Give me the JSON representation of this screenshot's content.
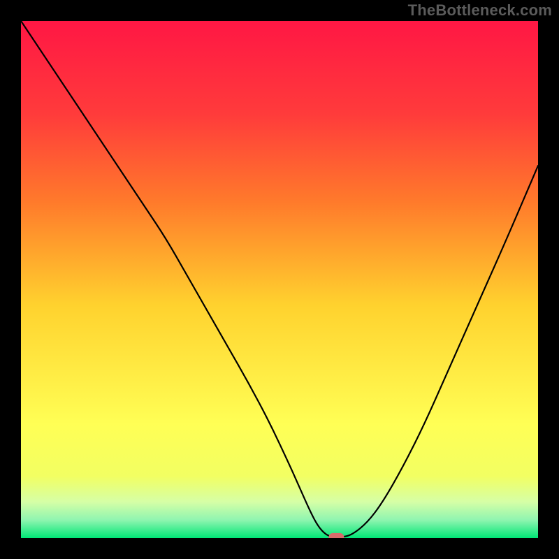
{
  "watermark": "TheBottleneck.com",
  "colors": {
    "frame_bg": "#000000",
    "gradient_top": "#ff1744",
    "gradient_upper_mid": "#ff7a2b",
    "gradient_mid": "#ffd22e",
    "gradient_lower_mid": "#f2ff62",
    "gradient_low": "#d6ffa6",
    "gradient_base": "#00e676",
    "curve": "#000000",
    "marker_fill": "#d86b6b",
    "marker_stroke": "#b24e4e"
  },
  "chart_data": {
    "type": "line",
    "title": "",
    "xlabel": "",
    "ylabel": "",
    "xlim": [
      0,
      100
    ],
    "ylim": [
      0,
      100
    ],
    "series": [
      {
        "name": "bottleneck-curve",
        "x": [
          0,
          6,
          12,
          18,
          24,
          28,
          32,
          36,
          40,
          44,
          48,
          52,
          54,
          56,
          57.5,
          59,
          60.5,
          62,
          64,
          67,
          70,
          74,
          78,
          82,
          86,
          90,
          94,
          100
        ],
        "y": [
          100,
          91,
          82,
          73,
          64,
          58,
          51,
          44,
          37,
          30,
          22.5,
          14,
          9.5,
          5,
          2.2,
          0.6,
          0.15,
          0.15,
          0.6,
          3,
          7,
          14,
          22,
          31,
          40,
          49,
          58,
          72
        ]
      }
    ],
    "annotations": [
      {
        "name": "optimal-marker",
        "x": 61,
        "y": 0.15
      }
    ]
  }
}
